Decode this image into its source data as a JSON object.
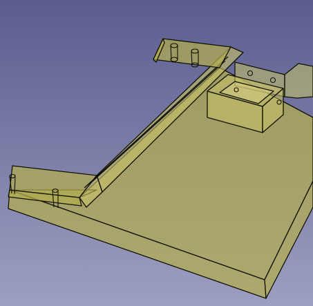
{
  "viewport": {
    "name": "3D view",
    "background": {
      "top": "#5a5d8e",
      "bottom": "#9d9fc1"
    }
  },
  "model": {
    "render_style": "transparent shaded",
    "face_color": "#b3ad4f",
    "face_color_light": "#c8c267",
    "edge_color": "#101000",
    "hole_color": "#e8e0a0"
  }
}
